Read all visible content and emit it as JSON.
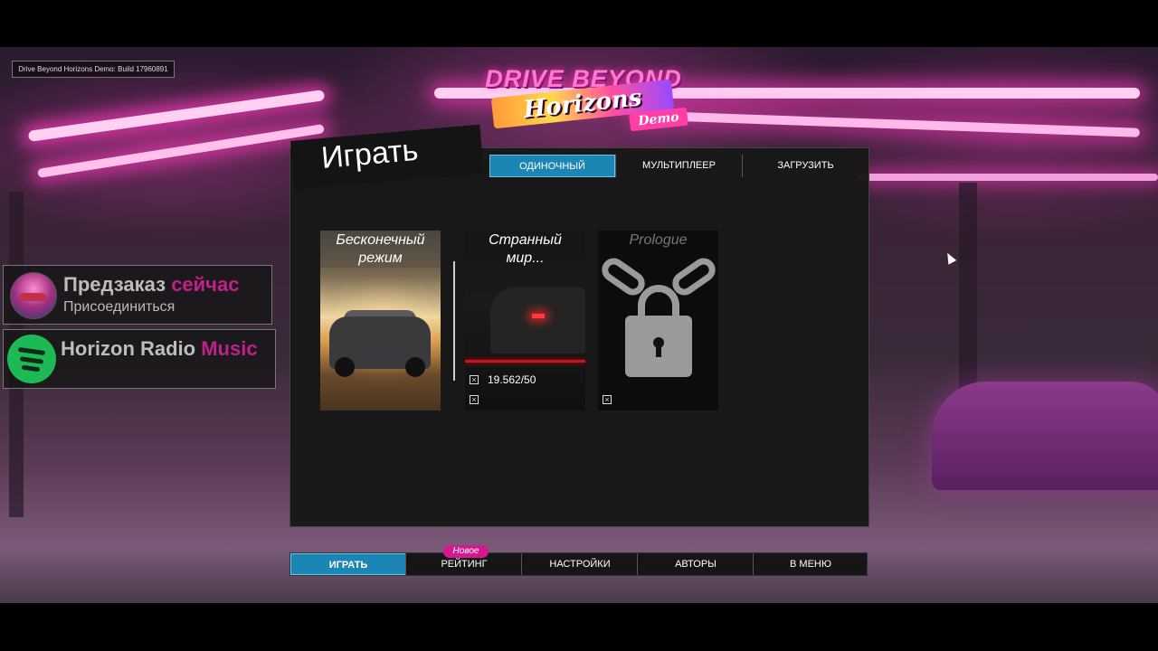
{
  "build_label": "Drive Beyond Horizons Demo: Build 17960891",
  "logo": {
    "top": "DRIVE BEYOND",
    "script": "Horizons",
    "tag": "Demo"
  },
  "promos": [
    {
      "title": "Предзаказ",
      "accent": "сейчас",
      "subtitle": "Присоединиться"
    },
    {
      "title": "Horizon Radio",
      "accent": "Music"
    }
  ],
  "panel": {
    "title": "Играть",
    "tabs": [
      {
        "label": "ОДИНОЧНЫЙ",
        "active": true
      },
      {
        "label": "МУЛЬТИПЛЕЕР",
        "active": false
      },
      {
        "label": "ЗАГРУЗИТЬ",
        "active": false
      }
    ],
    "cards": [
      {
        "label_line1": "Бесконечный",
        "label_line2": "режим"
      },
      {
        "label_line1": "Странный",
        "label_line2": "мир...",
        "stat": "19.562/50"
      },
      {
        "label_line1": "Prologue",
        "locked": true
      }
    ]
  },
  "menu": {
    "items": [
      {
        "label": "ИГРАТЬ",
        "active": true
      },
      {
        "label": "РЕЙТИНГ",
        "active": false
      },
      {
        "label": "НАСТРОЙКИ",
        "active": false
      },
      {
        "label": "АВТОРЫ",
        "active": false
      },
      {
        "label": "В МЕНЮ",
        "active": false
      }
    ],
    "badge": "Новое"
  },
  "colors": {
    "accent_blue": "#1b86b3",
    "accent_pink": "#d4198f",
    "neon": "#ff7ad2"
  }
}
